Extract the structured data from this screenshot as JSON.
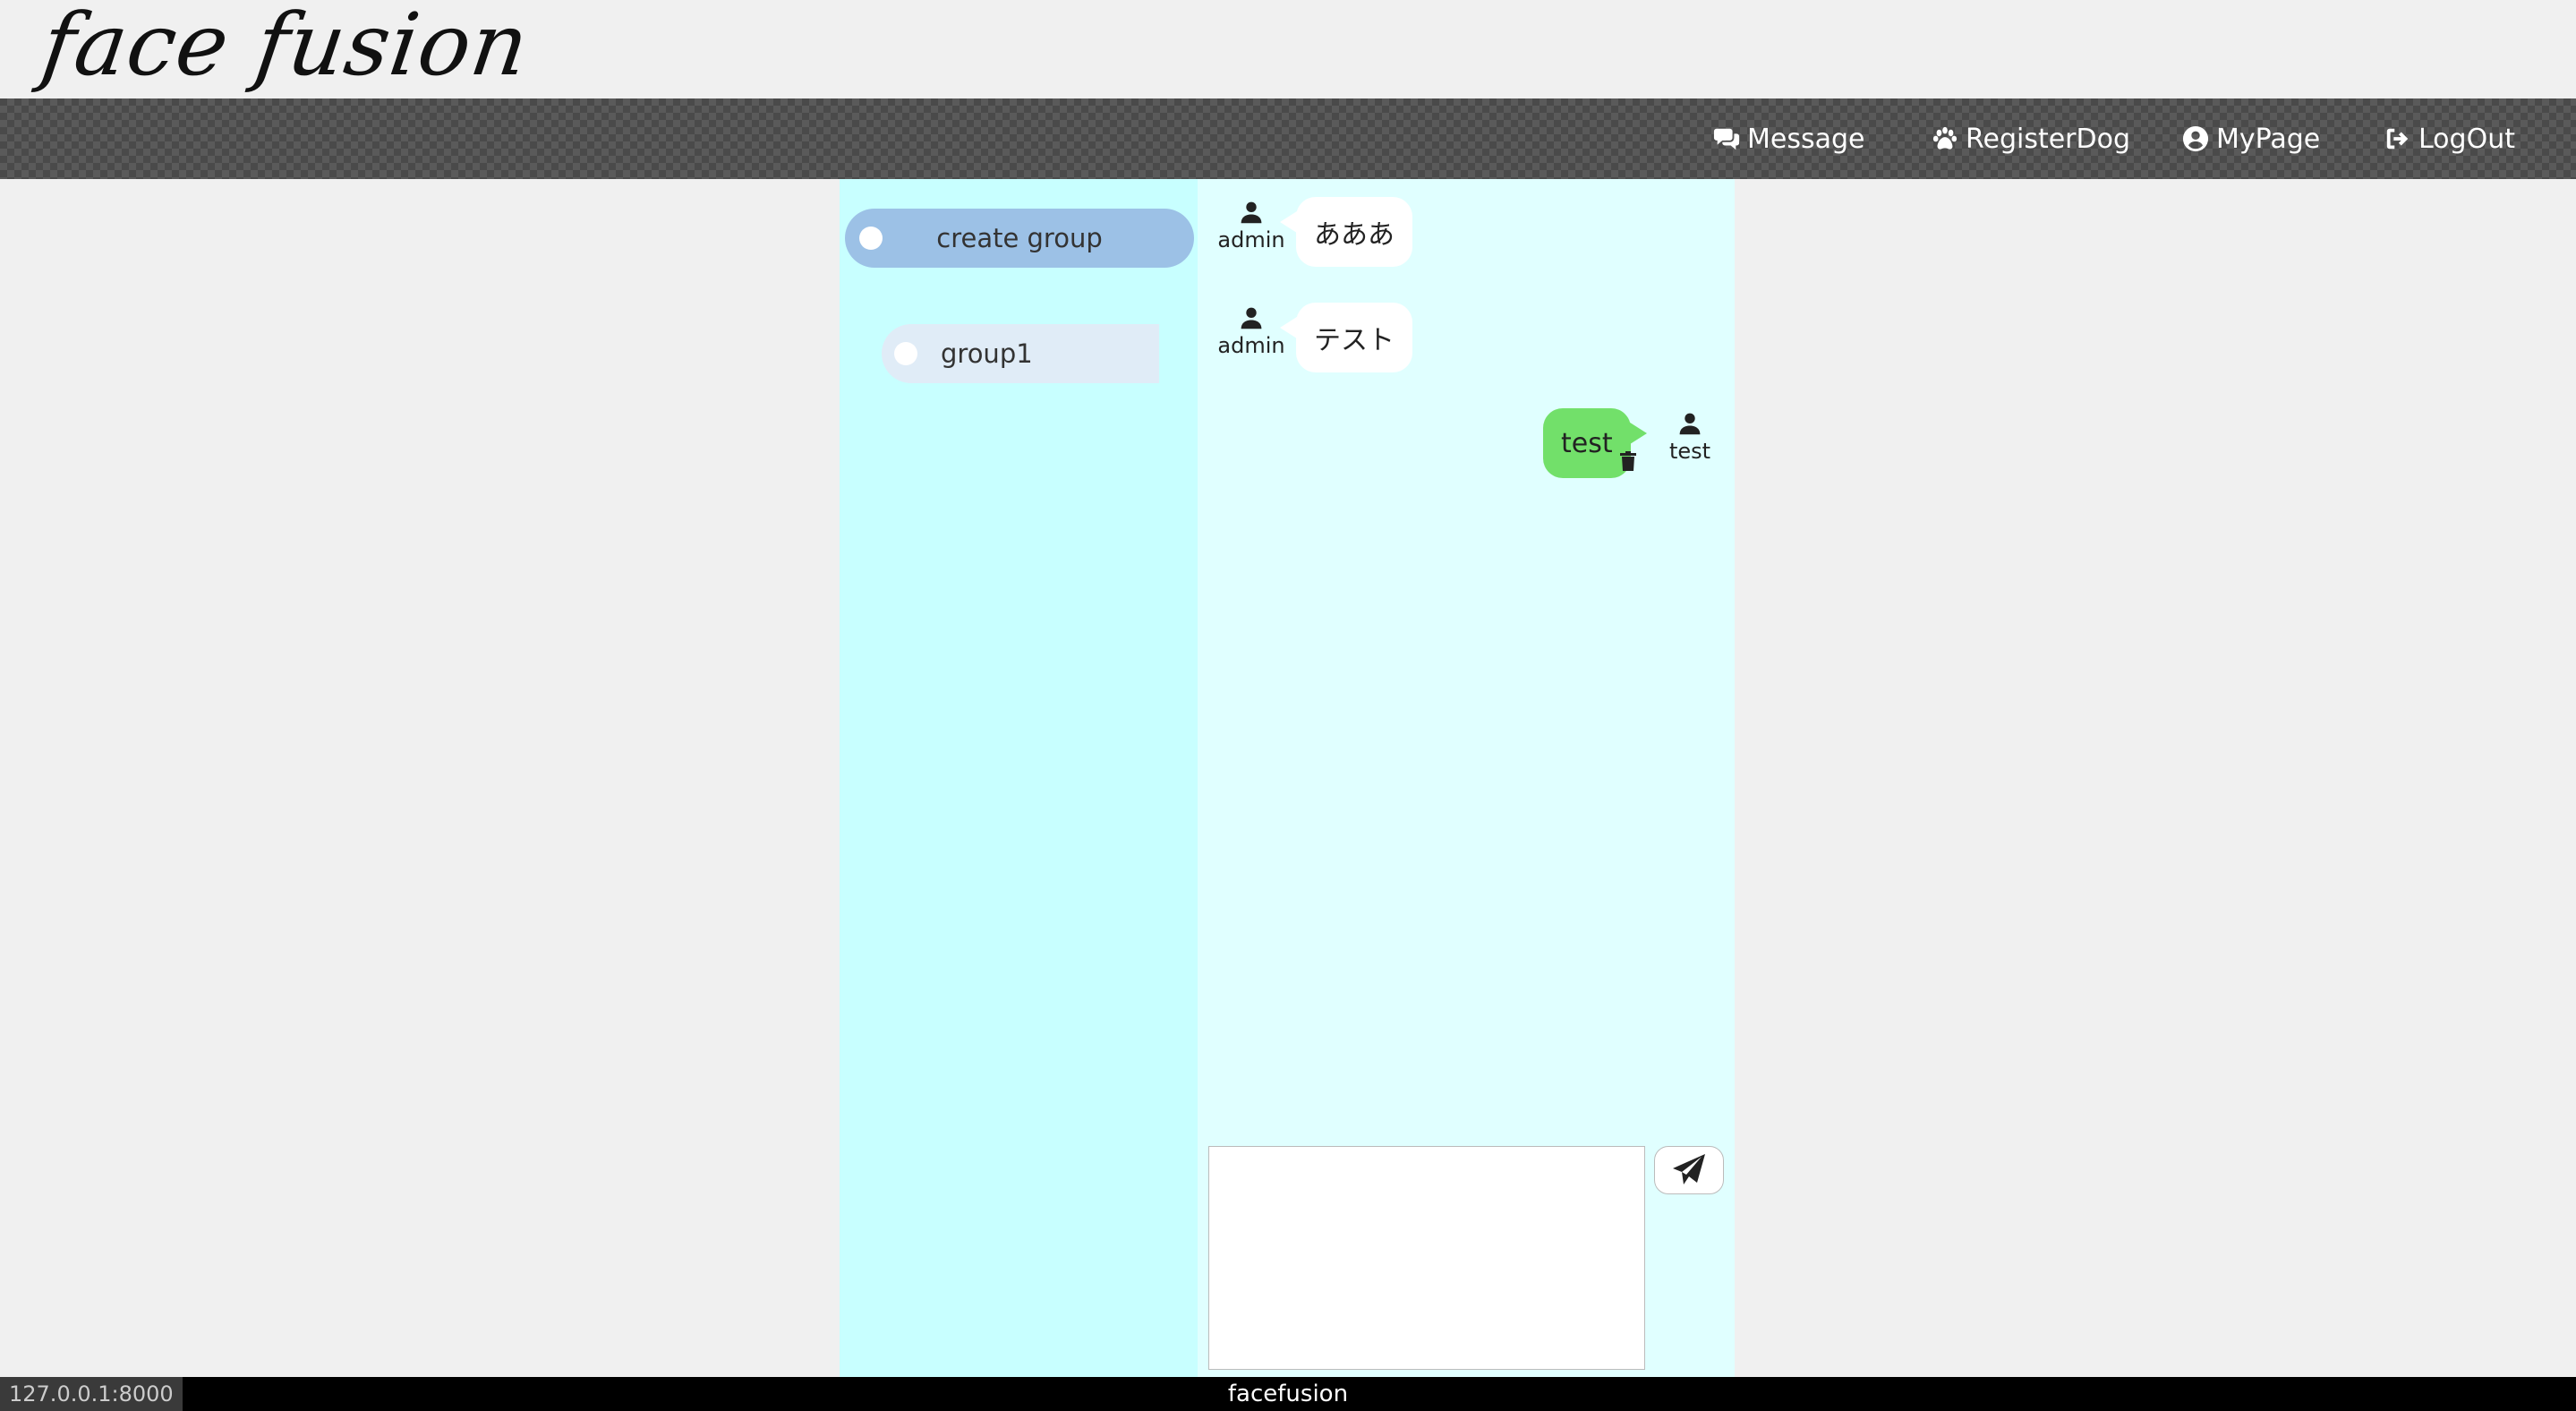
{
  "app": {
    "logo": "face fusion"
  },
  "nav": {
    "items": [
      {
        "label": "Message",
        "icon": "comments-icon"
      },
      {
        "label": "RegisterDog",
        "icon": "paw-icon"
      },
      {
        "label": "MyPage",
        "icon": "user-circle-icon"
      },
      {
        "label": "LogOut",
        "icon": "sign-out-icon"
      }
    ]
  },
  "groups": {
    "create_label": "create group",
    "items": [
      {
        "label": "group1"
      }
    ]
  },
  "messages": [
    {
      "user": "admin",
      "text": "あああ",
      "side": "left"
    },
    {
      "user": "admin",
      "text": "テスト",
      "side": "left"
    },
    {
      "user": "test",
      "text": "test",
      "side": "right",
      "deletable": true
    }
  ],
  "composer": {
    "value": "",
    "placeholder": ""
  },
  "footer": {
    "text": "facefusion"
  },
  "status_bar": {
    "url": "127.0.0.1:8000"
  },
  "colors": {
    "group_panel_bg": "#c8ffff",
    "chat_panel_bg": "#e0ffff",
    "create_group_bg": "#9cc1e6",
    "own_bubble": "#72e06a",
    "other_bubble": "#ffffff"
  }
}
